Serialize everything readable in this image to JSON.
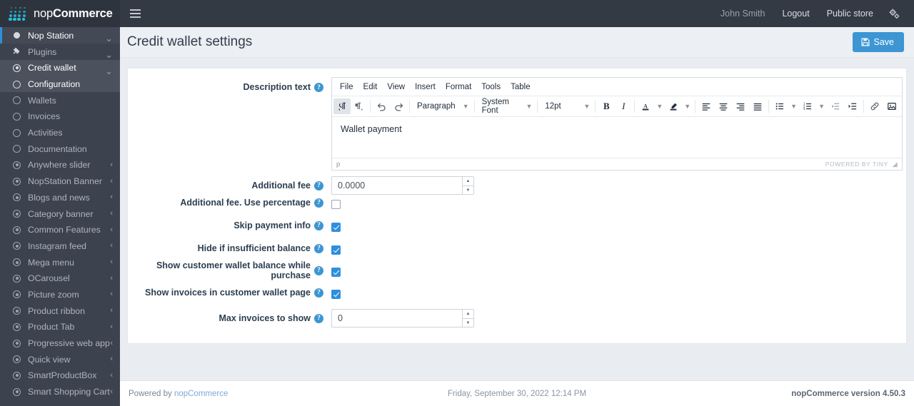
{
  "header": {
    "brand_prefix": "nop",
    "brand_suffix": "Commerce",
    "menu_icon": "hamburger-icon",
    "user_name": "John Smith",
    "logout_label": "Logout",
    "public_store_label": "Public store",
    "settings_icon": "gears-icon"
  },
  "sidebar": {
    "items": [
      {
        "label": "Nop Station",
        "icon": "circle-filled-icon",
        "caret": "⌄",
        "level": 0,
        "state": "active-top"
      },
      {
        "label": "Plugins",
        "icon": "puzzle-icon",
        "caret": "⌄",
        "level": 0,
        "state": "normal"
      },
      {
        "label": "Credit wallet",
        "icon": "radio-icon",
        "caret": "⌄",
        "level": 1,
        "state": "selected"
      },
      {
        "label": "Configuration",
        "icon": "circle-icon",
        "caret": "",
        "level": 1,
        "state": "selected-child"
      },
      {
        "label": "Wallets",
        "icon": "circle-icon",
        "caret": "",
        "level": 1,
        "state": "normal"
      },
      {
        "label": "Invoices",
        "icon": "circle-icon",
        "caret": "",
        "level": 1,
        "state": "normal"
      },
      {
        "label": "Activities",
        "icon": "circle-icon",
        "caret": "",
        "level": 1,
        "state": "normal"
      },
      {
        "label": "Documentation",
        "icon": "circle-icon",
        "caret": "",
        "level": 1,
        "state": "normal"
      },
      {
        "label": "Anywhere slider",
        "icon": "radio-icon",
        "caret": "‹",
        "level": 1,
        "state": "normal"
      },
      {
        "label": "NopStation Banner",
        "icon": "radio-icon",
        "caret": "‹",
        "level": 1,
        "state": "normal"
      },
      {
        "label": "Blogs and news",
        "icon": "radio-icon",
        "caret": "‹",
        "level": 1,
        "state": "normal"
      },
      {
        "label": "Category banner",
        "icon": "radio-icon",
        "caret": "‹",
        "level": 1,
        "state": "normal"
      },
      {
        "label": "Common Features",
        "icon": "radio-icon",
        "caret": "‹",
        "level": 1,
        "state": "normal"
      },
      {
        "label": "Instagram feed",
        "icon": "radio-icon",
        "caret": "‹",
        "level": 1,
        "state": "normal"
      },
      {
        "label": "Mega menu",
        "icon": "radio-icon",
        "caret": "‹",
        "level": 1,
        "state": "normal"
      },
      {
        "label": "OCarousel",
        "icon": "radio-icon",
        "caret": "‹",
        "level": 1,
        "state": "normal"
      },
      {
        "label": "Picture zoom",
        "icon": "radio-icon",
        "caret": "‹",
        "level": 1,
        "state": "normal"
      },
      {
        "label": "Product ribbon",
        "icon": "radio-icon",
        "caret": "‹",
        "level": 1,
        "state": "normal"
      },
      {
        "label": "Product Tab",
        "icon": "radio-icon",
        "caret": "‹",
        "level": 1,
        "state": "normal"
      },
      {
        "label": "Progressive web app",
        "icon": "radio-icon",
        "caret": "‹",
        "level": 1,
        "state": "normal"
      },
      {
        "label": "Quick view",
        "icon": "radio-icon",
        "caret": "‹",
        "level": 1,
        "state": "normal"
      },
      {
        "label": "SmartProductBox",
        "icon": "radio-icon",
        "caret": "‹",
        "level": 1,
        "state": "normal"
      },
      {
        "label": "Smart Shopping Cart",
        "icon": "radio-icon",
        "caret": "‹",
        "level": 1,
        "state": "normal"
      }
    ]
  },
  "page": {
    "title": "Credit wallet settings",
    "save_label": "Save",
    "save_icon": "floppy-disk-icon"
  },
  "editor": {
    "menus": [
      "File",
      "Edit",
      "View",
      "Insert",
      "Format",
      "Tools",
      "Table"
    ],
    "paragraph_style": "Paragraph",
    "font_family": "System Font",
    "font_size": "12pt",
    "content": "Wallet payment",
    "status_path": "p",
    "powered_by": "POWERED BY TINY",
    "toolbar_icons": [
      "ltr-direction-icon",
      "rtl-direction-icon",
      "undo-icon",
      "redo-icon",
      "bold-icon",
      "italic-icon",
      "text-color-icon",
      "highlight-color-icon",
      "align-left-icon",
      "align-center-icon",
      "align-right-icon",
      "align-justify-icon",
      "bullet-list-icon",
      "numbered-list-icon",
      "outdent-icon",
      "indent-icon",
      "link-icon",
      "image-icon"
    ]
  },
  "form": {
    "description_text": {
      "label": "Description text",
      "help": "?"
    },
    "additional_fee": {
      "label": "Additional fee",
      "help": "?",
      "value": "0.0000"
    },
    "use_percentage": {
      "label": "Additional fee. Use percentage",
      "help": "?",
      "checked": false
    },
    "skip_payment_info": {
      "label": "Skip payment info",
      "help": "?",
      "checked": true
    },
    "hide_if_insufficient": {
      "label": "Hide if insufficient balance",
      "help": "?",
      "checked": true
    },
    "show_balance": {
      "label": "Show customer wallet balance while purchase",
      "help": "?",
      "checked": true
    },
    "show_invoices": {
      "label": "Show invoices in customer wallet page",
      "help": "?",
      "checked": true
    },
    "max_invoices": {
      "label": "Max invoices to show",
      "help": "?",
      "value": "0"
    }
  },
  "footer": {
    "powered_by_prefix": "Powered by ",
    "powered_by_link": "nopCommerce",
    "datetime": "Friday, September 30, 2022 12:14 PM",
    "version": "nopCommerce version 4.50.3"
  },
  "colors": {
    "accent": "#3d96d3",
    "topbar": "#343a44",
    "sidebar": "#3d434e",
    "brand_cyan": "#25c3dd",
    "page_bg": "#e9edf2"
  }
}
